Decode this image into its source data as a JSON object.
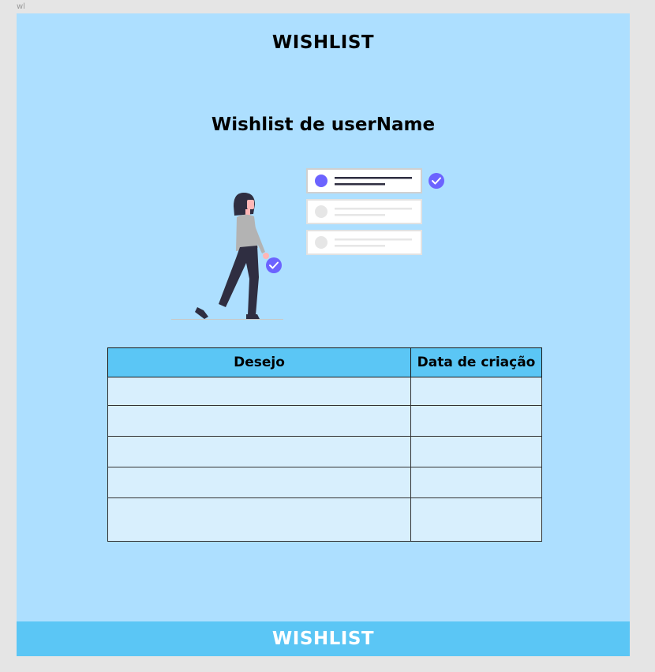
{
  "frame": {
    "label": "wl"
  },
  "header": {
    "title": "WISHLIST"
  },
  "page": {
    "title": "Wishlist de userName"
  },
  "illustration": {
    "icon": "woman-checklist-illustration",
    "accent": "#6c63ff"
  },
  "table": {
    "columns": [
      "Desejo",
      "Data de criação"
    ],
    "rows": [
      [
        "",
        ""
      ],
      [
        "",
        ""
      ],
      [
        "",
        ""
      ],
      [
        "",
        ""
      ],
      [
        "",
        ""
      ]
    ]
  },
  "footer": {
    "title": "WISHLIST"
  },
  "colors": {
    "background": "#addfff",
    "header_cell": "#5bc6f5",
    "row_cell": "#d8effd",
    "footer": "#5bc6f5"
  }
}
